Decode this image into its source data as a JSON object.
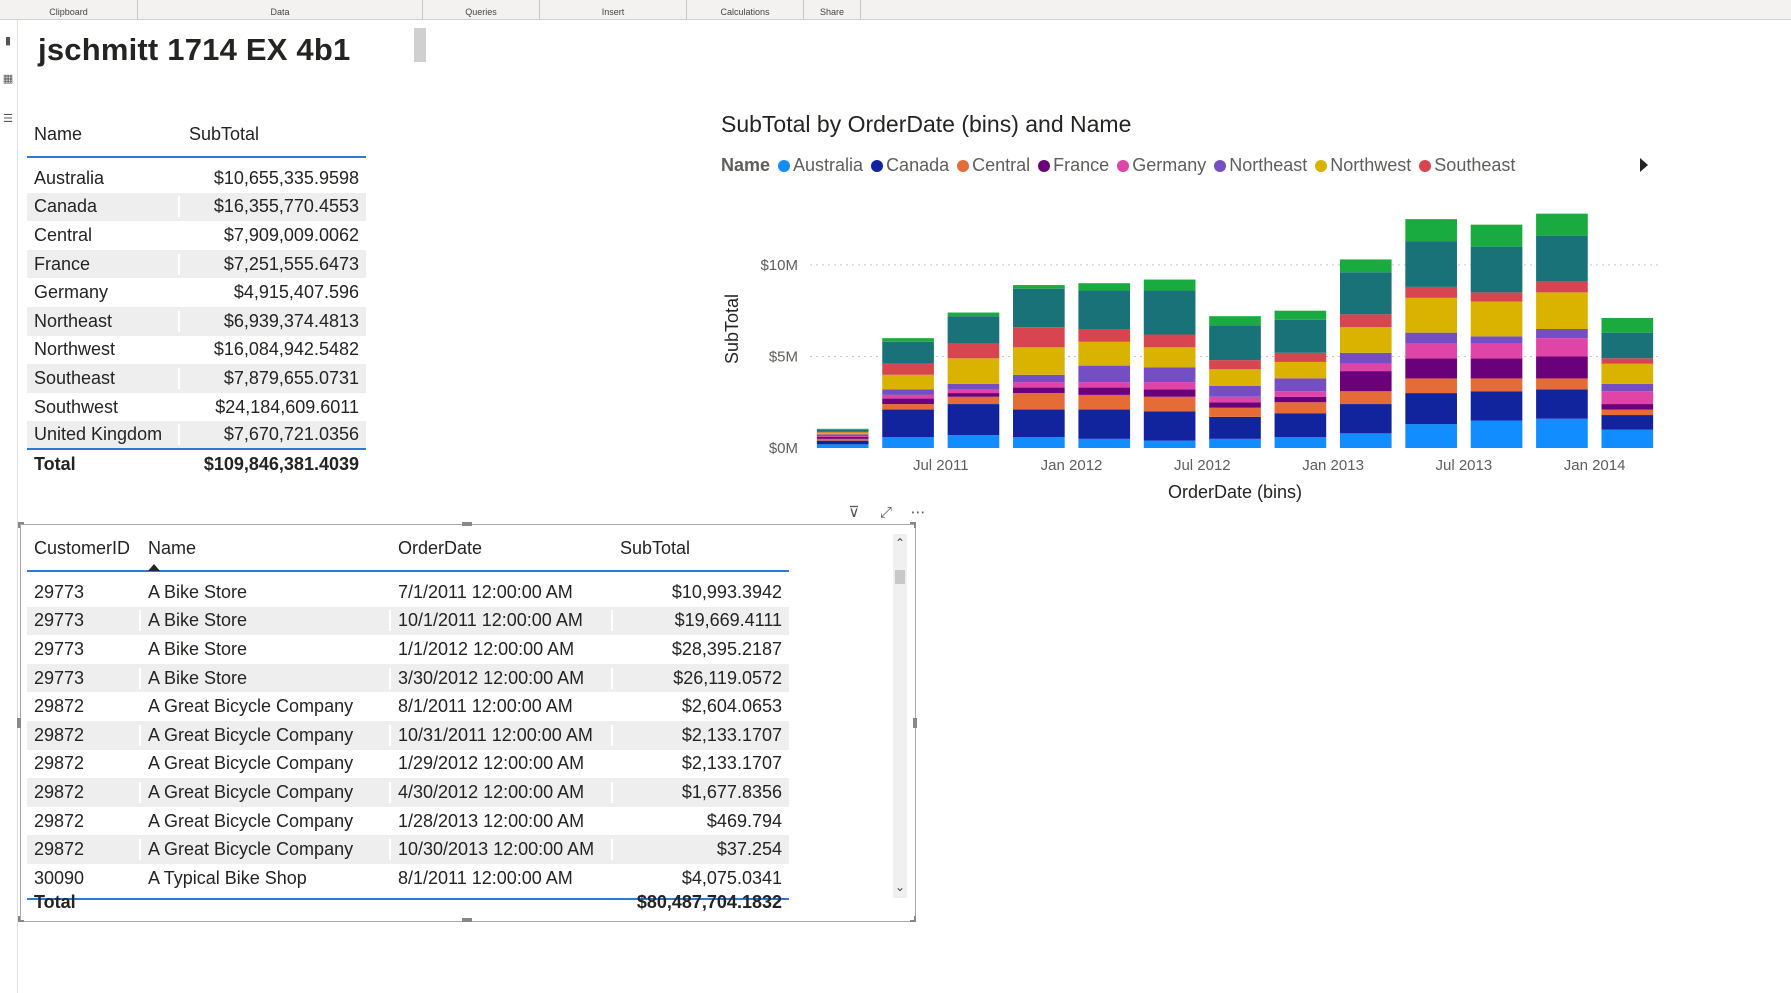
{
  "ribbon": {
    "groups": [
      "Clipboard",
      "Data",
      "Queries",
      "Insert",
      "Calculations",
      "Share"
    ]
  },
  "page": {
    "title": "jschmitt 1714 EX 4b1"
  },
  "summary_table": {
    "headers": [
      "Name",
      "SubTotal"
    ],
    "rows": [
      {
        "name": "Australia",
        "subtotal": "$10,655,335.9598"
      },
      {
        "name": "Canada",
        "subtotal": "$16,355,770.4553"
      },
      {
        "name": "Central",
        "subtotal": "$7,909,009.0062"
      },
      {
        "name": "France",
        "subtotal": "$7,251,555.6473"
      },
      {
        "name": "Germany",
        "subtotal": "$4,915,407.596"
      },
      {
        "name": "Northeast",
        "subtotal": "$6,939,374.4813"
      },
      {
        "name": "Northwest",
        "subtotal": "$16,084,942.5482"
      },
      {
        "name": "Southeast",
        "subtotal": "$7,879,655.0731"
      },
      {
        "name": "Southwest",
        "subtotal": "$24,184,609.6011"
      },
      {
        "name": "United Kingdom",
        "subtotal": "$7,670,721.0356"
      }
    ],
    "total_label": "Total",
    "total_value": "$109,846,381.4039"
  },
  "chart": {
    "title": "SubTotal by OrderDate (bins) and Name",
    "legend_title": "Name",
    "legend": [
      {
        "name": "Australia",
        "color": "#118dff"
      },
      {
        "name": "Canada",
        "color": "#12239e"
      },
      {
        "name": "Central",
        "color": "#e66c37"
      },
      {
        "name": "France",
        "color": "#6b007b"
      },
      {
        "name": "Germany",
        "color": "#e044a7"
      },
      {
        "name": "Northeast",
        "color": "#744ec2"
      },
      {
        "name": "Northwest",
        "color": "#d9b300"
      },
      {
        "name": "Southeast",
        "color": "#d64550"
      }
    ],
    "extra_series_colors": {
      "Southwest": "#197278",
      "United Kingdom": "#1aab40"
    },
    "next_page_icon": "triangle-right-icon"
  },
  "chart_data": {
    "type": "bar",
    "stacked": true,
    "title": "SubTotal by OrderDate (bins) and Name",
    "xlabel": "OrderDate (bins)",
    "ylabel": "SubTotal",
    "ylim": [
      0,
      13000000
    ],
    "y_ticks": [
      {
        "label": "$0M",
        "value": 0
      },
      {
        "label": "$5M",
        "value": 5000000
      },
      {
        "label": "$10M",
        "value": 10000000
      }
    ],
    "x_ticks": [
      {
        "label": "Jul 2011",
        "bin": 1
      },
      {
        "label": "Jan 2012",
        "bin": 3
      },
      {
        "label": "Jul 2012",
        "bin": 5
      },
      {
        "label": "Jan 2013",
        "bin": 7
      },
      {
        "label": "Jul 2013",
        "bin": 9
      },
      {
        "label": "Jan 2014",
        "bin": 11
      }
    ],
    "grid": true,
    "legend_position": "top",
    "series_order": [
      "Australia",
      "Canada",
      "Central",
      "France",
      "Germany",
      "Northeast",
      "Northwest",
      "Southeast",
      "Southwest",
      "United Kingdom"
    ],
    "stacks": [
      {
        "Australia": 200000,
        "Canada": 200000,
        "Central": 100000,
        "France": 100000,
        "Germany": 50000,
        "Northeast": 100000,
        "Northwest": 100000,
        "Southeast": 50000,
        "Southwest": 100000,
        "United Kingdom": 50000
      },
      {
        "Australia": 600000,
        "Canada": 1500000,
        "Central": 300000,
        "France": 300000,
        "Germany": 200000,
        "Northeast": 300000,
        "Northwest": 800000,
        "Southeast": 600000,
        "Southwest": 1200000,
        "United Kingdom": 200000
      },
      {
        "Australia": 700000,
        "Canada": 1700000,
        "Central": 400000,
        "France": 200000,
        "Germany": 200000,
        "Northeast": 300000,
        "Northwest": 1400000,
        "Southeast": 800000,
        "Southwest": 1500000,
        "United Kingdom": 200000
      },
      {
        "Australia": 600000,
        "Canada": 1500000,
        "Central": 900000,
        "France": 300000,
        "Germany": 300000,
        "Northeast": 400000,
        "Northwest": 1500000,
        "Southeast": 1100000,
        "Southwest": 2100000,
        "United Kingdom": 200000
      },
      {
        "Australia": 500000,
        "Canada": 1600000,
        "Central": 800000,
        "France": 400000,
        "Germany": 300000,
        "Northeast": 900000,
        "Northwest": 1300000,
        "Southeast": 700000,
        "Southwest": 2100000,
        "United Kingdom": 400000
      },
      {
        "Australia": 400000,
        "Canada": 1600000,
        "Central": 800000,
        "France": 400000,
        "Germany": 400000,
        "Northeast": 800000,
        "Northwest": 1100000,
        "Southeast": 700000,
        "Southwest": 2400000,
        "United Kingdom": 600000
      },
      {
        "Australia": 500000,
        "Canada": 1200000,
        "Central": 500000,
        "France": 300000,
        "Germany": 300000,
        "Northeast": 600000,
        "Northwest": 900000,
        "Southeast": 500000,
        "Southwest": 1900000,
        "United Kingdom": 500000
      },
      {
        "Australia": 600000,
        "Canada": 1300000,
        "Central": 600000,
        "France": 300000,
        "Germany": 300000,
        "Northeast": 700000,
        "Northwest": 900000,
        "Southeast": 500000,
        "Southwest": 1800000,
        "United Kingdom": 500000
      },
      {
        "Australia": 800000,
        "Canada": 1600000,
        "Central": 700000,
        "France": 1100000,
        "Germany": 400000,
        "Northeast": 600000,
        "Northwest": 1400000,
        "Southeast": 700000,
        "Southwest": 2300000,
        "United Kingdom": 700000
      },
      {
        "Australia": 1300000,
        "Canada": 1700000,
        "Central": 800000,
        "France": 1100000,
        "Germany": 800000,
        "Northeast": 600000,
        "Northwest": 1900000,
        "Southeast": 600000,
        "Southwest": 2500000,
        "United Kingdom": 1200000
      },
      {
        "Australia": 1500000,
        "Canada": 1600000,
        "Central": 700000,
        "France": 1100000,
        "Germany": 800000,
        "Northeast": 400000,
        "Northwest": 1900000,
        "Southeast": 500000,
        "Southwest": 2500000,
        "United Kingdom": 1200000
      },
      {
        "Australia": 1600000,
        "Canada": 1600000,
        "Central": 600000,
        "France": 1200000,
        "Germany": 1000000,
        "Northeast": 500000,
        "Northwest": 2000000,
        "Southeast": 600000,
        "Southwest": 2500000,
        "United Kingdom": 1200000
      },
      {
        "Australia": 1000000,
        "Canada": 800000,
        "Central": 300000,
        "France": 300000,
        "Germany": 700000,
        "Northeast": 400000,
        "Northwest": 1100000,
        "Southeast": 300000,
        "Southwest": 1400000,
        "United Kingdom": 800000
      }
    ]
  },
  "detail_table": {
    "headers": [
      "CustomerID",
      "Name",
      "OrderDate",
      "SubTotal"
    ],
    "rows": [
      [
        "29773",
        "A Bike Store",
        "7/1/2011 12:00:00 AM",
        "$10,993.3942"
      ],
      [
        "29773",
        "A Bike Store",
        "10/1/2011 12:00:00 AM",
        "$19,669.4111"
      ],
      [
        "29773",
        "A Bike Store",
        "1/1/2012 12:00:00 AM",
        "$28,395.2187"
      ],
      [
        "29773",
        "A Bike Store",
        "3/30/2012 12:00:00 AM",
        "$26,119.0572"
      ],
      [
        "29872",
        "A Great Bicycle Company",
        "8/1/2011 12:00:00 AM",
        "$2,604.0653"
      ],
      [
        "29872",
        "A Great Bicycle Company",
        "10/31/2011 12:00:00 AM",
        "$2,133.1707"
      ],
      [
        "29872",
        "A Great Bicycle Company",
        "1/29/2012 12:00:00 AM",
        "$2,133.1707"
      ],
      [
        "29872",
        "A Great Bicycle Company",
        "4/30/2012 12:00:00 AM",
        "$1,677.8356"
      ],
      [
        "29872",
        "A Great Bicycle Company",
        "1/28/2013 12:00:00 AM",
        "$469.794"
      ],
      [
        "29872",
        "A Great Bicycle Company",
        "10/30/2013 12:00:00 AM",
        "$37.254"
      ],
      [
        "30090",
        "A Typical Bike Shop",
        "8/1/2011 12:00:00 AM",
        "$4,075.0341"
      ]
    ],
    "total_label": "Total",
    "total_value": "$80,487,704.1832",
    "sorted_column": "Name",
    "header_icons": [
      "filter-icon",
      "focus-mode-icon",
      "more-options-icon"
    ]
  }
}
